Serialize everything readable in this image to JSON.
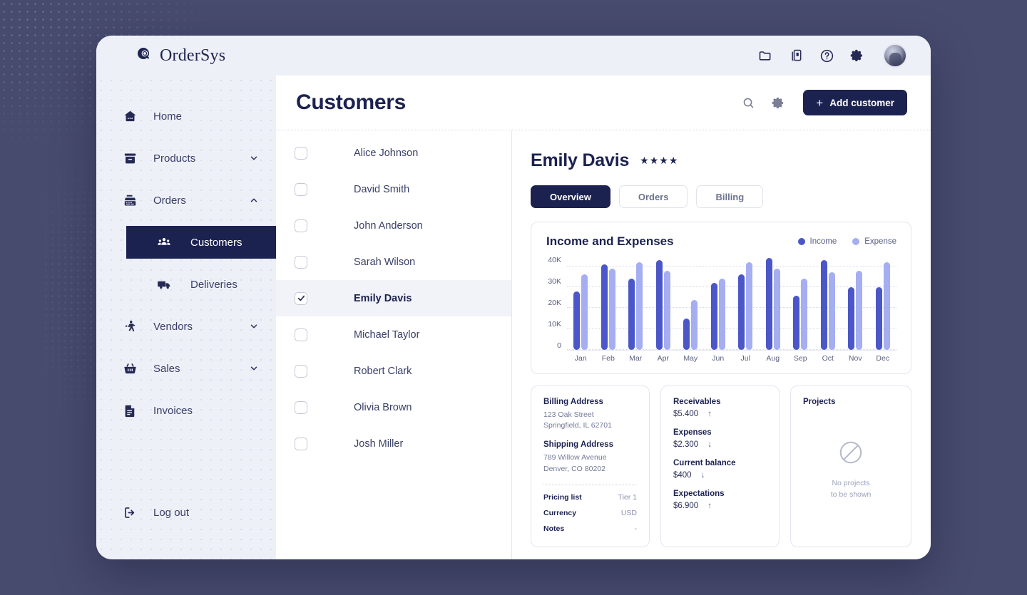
{
  "brand": {
    "name": "OrderSys",
    "logo_icon": "order-search-logo-icon"
  },
  "topbar": {
    "icons": [
      {
        "name": "folder-icon"
      },
      {
        "name": "device-mobile-icon"
      },
      {
        "name": "help-circle-icon"
      },
      {
        "name": "gear-icon"
      }
    ],
    "avatar": "user-avatar"
  },
  "sidebar": {
    "items": [
      {
        "label": "Home",
        "icon": "home-icon",
        "expandable": false
      },
      {
        "label": "Products",
        "icon": "archive-box-icon",
        "expandable": true,
        "chevron": "chevron-down-icon"
      },
      {
        "label": "Orders",
        "icon": "cash-register-icon",
        "expandable": true,
        "chevron": "chevron-up-icon",
        "expanded": true
      },
      {
        "label": "Vendors",
        "icon": "walking-person-icon",
        "expandable": true,
        "chevron": "chevron-down-icon"
      },
      {
        "label": "Sales",
        "icon": "shopping-basket-icon",
        "expandable": true,
        "chevron": "chevron-down-icon"
      },
      {
        "label": "Invoices",
        "icon": "document-icon",
        "expandable": false
      }
    ],
    "sub_items": [
      {
        "label": "Customers",
        "icon": "people-group-icon",
        "active": true
      },
      {
        "label": "Deliveries",
        "icon": "delivery-truck-icon",
        "active": false
      }
    ],
    "logout": {
      "label": "Log out",
      "icon": "logout-arrow-icon"
    }
  },
  "header": {
    "title": "Customers",
    "search_icon": "search-icon",
    "settings_icon": "gear-icon",
    "add_button": {
      "label": "Add customer",
      "plus": "+"
    }
  },
  "customers": [
    {
      "name": "Alice Johnson",
      "checked": false
    },
    {
      "name": "David Smith",
      "checked": false
    },
    {
      "name": "John Anderson",
      "checked": false
    },
    {
      "name": "Sarah Wilson",
      "checked": false
    },
    {
      "name": "Emily Davis",
      "checked": true
    },
    {
      "name": "Michael Taylor",
      "checked": false
    },
    {
      "name": "Robert Clark",
      "checked": false
    },
    {
      "name": "Olivia Brown",
      "checked": false
    },
    {
      "name": "Josh Miller",
      "checked": false
    }
  ],
  "detail": {
    "name": "Emily Davis",
    "rating": 4,
    "rating_glyph": "★",
    "tabs": [
      {
        "label": "Overview",
        "active": true
      },
      {
        "label": "Orders",
        "active": false
      },
      {
        "label": "Billing",
        "active": false
      }
    ]
  },
  "chart_data": {
    "type": "bar",
    "title": "Income and Expenses",
    "xlabel": "",
    "ylabel": "",
    "ylim": [
      0,
      45000
    ],
    "yticks": [
      0,
      10000,
      20000,
      30000,
      40000
    ],
    "ytick_labels": [
      "0",
      "10K",
      "20K",
      "30K",
      "40K"
    ],
    "grid": true,
    "legend_position": "top-right",
    "categories": [
      "Jan",
      "Feb",
      "Mar",
      "Apr",
      "May",
      "Jun",
      "Jul",
      "Aug",
      "Sep",
      "Oct",
      "Nov",
      "Dec"
    ],
    "series": [
      {
        "name": "Income",
        "color": "#4b57c8",
        "values": [
          28000,
          41000,
          34000,
          43000,
          15000,
          32000,
          36000,
          44000,
          26000,
          43000,
          30000,
          30000
        ]
      },
      {
        "name": "Expense",
        "color": "#a5aef0",
        "values": [
          36000,
          39000,
          42000,
          38000,
          24000,
          34000,
          42000,
          39000,
          34000,
          37000,
          38000,
          42000
        ]
      }
    ]
  },
  "billing_card": {
    "billing_title": "Billing Address",
    "billing_line1": "123 Oak Street",
    "billing_line2": "Springfield, IL 62701",
    "shipping_title": "Shipping Address",
    "shipping_line1": "789 Willow Avenue",
    "shipping_line2": "Denver, CO 80202",
    "rows": [
      {
        "key": "Pricing list",
        "value": "Tier 1"
      },
      {
        "key": "Currency",
        "value": "USD"
      },
      {
        "key": "Notes",
        "value": "-"
      }
    ]
  },
  "finance_card": {
    "items": [
      {
        "label": "Receivables",
        "value": "$5.400",
        "arrow": "↑"
      },
      {
        "label": "Expenses",
        "value": "$2.300",
        "arrow": "↓"
      },
      {
        "label": "Current balance",
        "value": "$400",
        "arrow": "↓"
      },
      {
        "label": "Expectations",
        "value": "$6.900",
        "arrow": "↑"
      }
    ]
  },
  "projects_card": {
    "title": "Projects",
    "empty_icon": "no-entry-icon",
    "empty_line1": "No projects",
    "empty_line2": "to be shown"
  },
  "colors": {
    "page_background": "#474b6e",
    "sidebar": "#eef0f7",
    "accent_navy": "#1c2250",
    "income": "#4b57c8",
    "expense": "#a5aef0"
  }
}
